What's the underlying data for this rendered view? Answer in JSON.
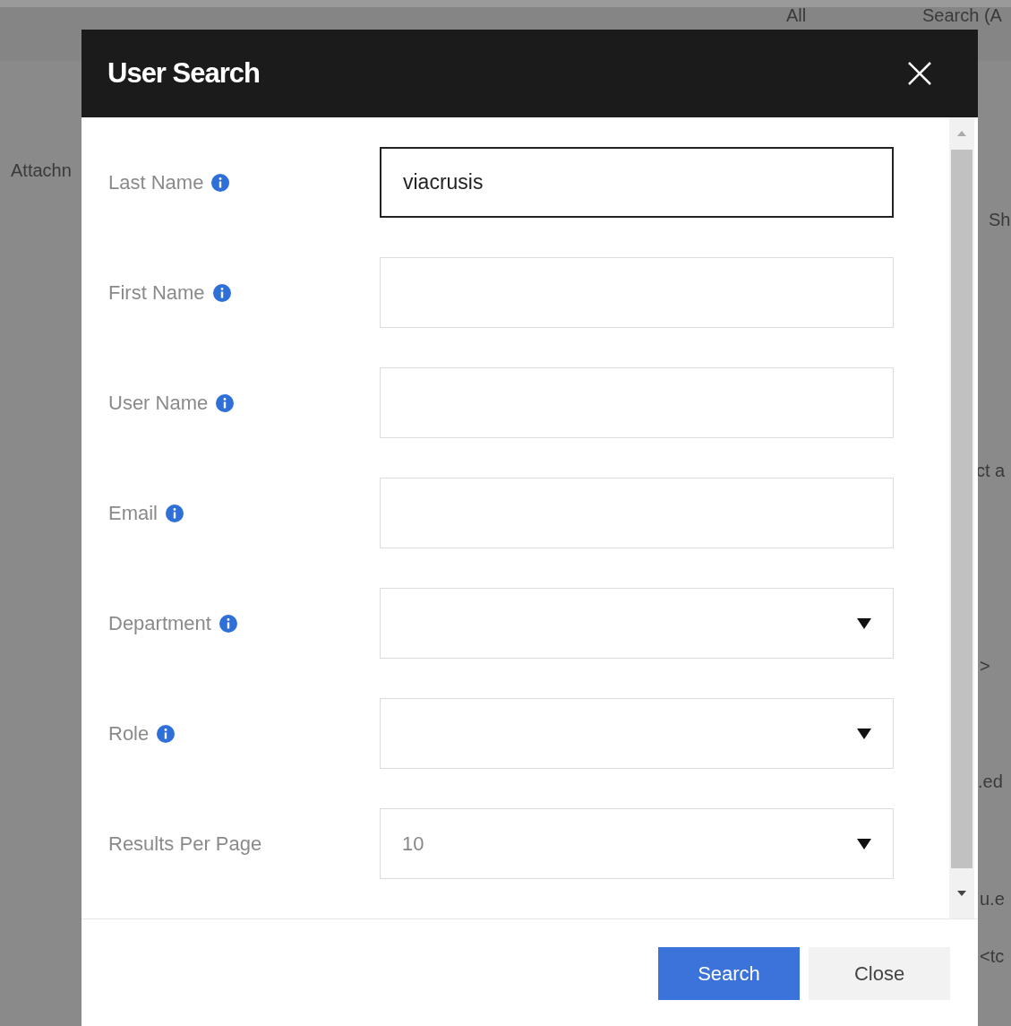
{
  "background": {
    "texts": [
      "All",
      "Search (A",
      "Attachn",
      "Sh",
      "ct a",
      ">",
      ".ed",
      "u.e",
      "<tc"
    ]
  },
  "dialog": {
    "title": "User Search",
    "fields": [
      {
        "kind": "text",
        "label": "Last Name",
        "info": true,
        "value": "viacrusis",
        "focused": true
      },
      {
        "kind": "text",
        "label": "First Name",
        "info": true,
        "focused": false
      },
      {
        "kind": "text",
        "label": "User Name",
        "info": true,
        "focused": false
      },
      {
        "kind": "text",
        "label": "Email",
        "info": true,
        "focused": false
      },
      {
        "kind": "select",
        "label": "Department",
        "info": true,
        "focused": false
      },
      {
        "kind": "select",
        "label": "Role",
        "info": true,
        "focused": false
      },
      {
        "kind": "select",
        "label": "Results Per Page",
        "info": false,
        "value": "10",
        "focused": false
      }
    ],
    "buttons": [
      {
        "label": "Search",
        "kind": "primary"
      },
      {
        "label": "Close",
        "kind": "secondary"
      }
    ]
  }
}
